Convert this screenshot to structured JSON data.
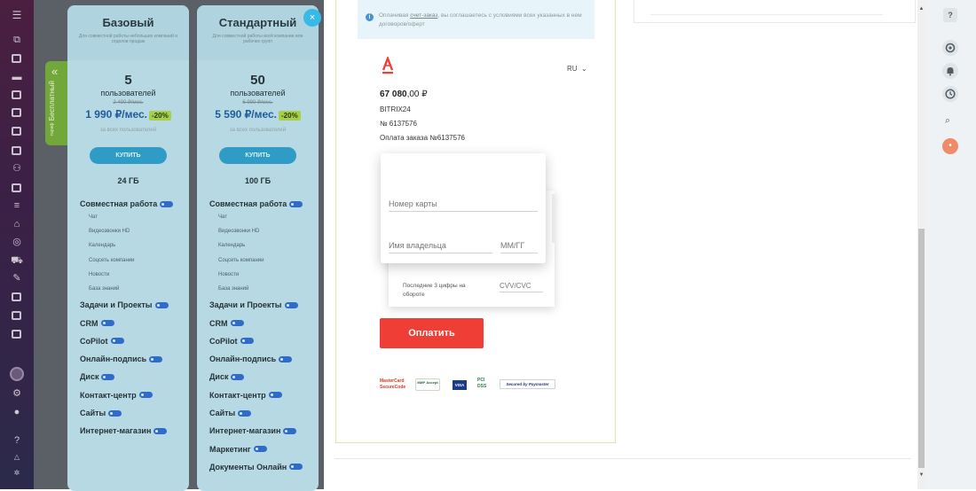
{
  "plans": [
    {
      "title": "Базовый",
      "description": "Для совместной работы небольших компаний и отделов продаж",
      "users_count": "5",
      "users_label": "пользователей",
      "old_price": "2 490 ₽/мес.",
      "price": "1 990 ₽/мес.",
      "discount": "-20%",
      "per_users": "за всех пользователей",
      "buy_label": "КУПИТЬ",
      "storage": "24 ГБ"
    },
    {
      "title": "Стандартный",
      "description": "Для совместной работы всей компании или рабочих групп",
      "users_count": "50",
      "users_label": "пользователей",
      "old_price": "6 990 ₽/мес.",
      "price": "5 590 ₽/мес.",
      "discount": "-20%",
      "per_users": "за всех пользователей",
      "buy_label": "КУПИТЬ",
      "storage": "100 ГБ"
    }
  ],
  "features": {
    "collab": "Совместная работа",
    "chat": "Чат",
    "video": "Видеозвонки HD",
    "calendar": "Календарь",
    "social": "Соцсеть компании",
    "news": "Новости",
    "kb": "База знаний",
    "tasks": "Задачи и Проекты",
    "crm": "CRM",
    "copilot": "CoPilot",
    "esign": "Онлайн-подпись",
    "disk": "Диск",
    "contact": "Контакт-центр",
    "sites": "Сайты",
    "shop": "Интернет-магазин",
    "marketing": "Маркетинг",
    "docs": "Документы Онлайн"
  },
  "trial_tab": {
    "label": "Бесплатный",
    "small": "тариф",
    "arrow": "«"
  },
  "close_label": "×",
  "notice": {
    "icon": "i",
    "prefix": "Оплачивая ",
    "link": "счет-заказ",
    "suffix": ", вы соглашаетесь с условиями всех указанных в нем договоров/оферт"
  },
  "payment": {
    "bank_logo_letter": "A",
    "language": "RU",
    "language_chevron": "⌄",
    "amount_main": "67 080",
    "amount_rest": ",00 ₽",
    "merchant": "BITRIX24",
    "order_no": "№ 6137576",
    "order_desc": "Оплата заказа №6137576",
    "card_number_placeholder": "Номер карты",
    "holder_placeholder": "Имя владельца",
    "expiry_placeholder": "ММ/ГГ",
    "cvv_hint": "Последние 3 цифры на обороте",
    "cvv_placeholder": "CVV/CVC",
    "pay_label": "Оплатить"
  },
  "badges": {
    "mastercard": "MasterCard SecureCode",
    "mir": "МИР Accept",
    "visa": "VISA",
    "pci": "PCI DSS",
    "secured": "Secured by Paymaster"
  },
  "right_bar": {
    "help": "?",
    "search": "⌕",
    "avatar": "•"
  },
  "scroll": {
    "up": "▲",
    "down": "▼"
  },
  "colors": {
    "accent_red": "#ef3e36",
    "close_blue": "#39b9e8",
    "trial_green": "#72a83a",
    "buy_blue": "#2f9cc6",
    "discount_green": "#a7d04a"
  }
}
